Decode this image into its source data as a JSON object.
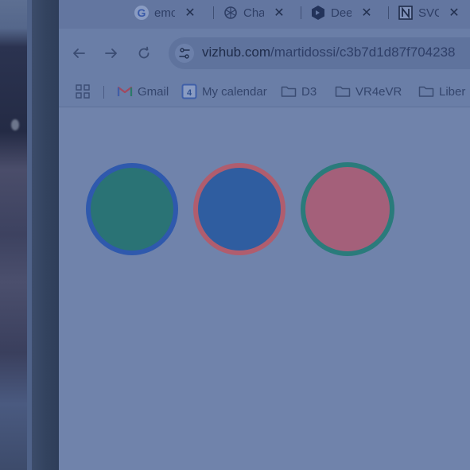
{
  "tabs": [
    {
      "label": "emo",
      "favicon": "google-icon"
    },
    {
      "label": "Cha",
      "favicon": "openai-icon"
    },
    {
      "label": "Dee",
      "favicon": "deepseek-icon"
    },
    {
      "label": "SVG",
      "favicon": "notion-icon"
    }
  ],
  "tab_close_glyph": "✕",
  "toolbar": {
    "back_icon": "back-arrow-icon",
    "forward_icon": "forward-arrow-icon",
    "reload_icon": "reload-icon",
    "site_info_icon": "tune-icon"
  },
  "address": {
    "host": "vizhub.com",
    "path": "/martidossi/c3b7d1d87f704238"
  },
  "bookmarks": [
    {
      "label": "",
      "icon": "apps-grid-icon"
    },
    {
      "label": "Gmail",
      "icon": "gmail-icon"
    },
    {
      "label": "My calendar",
      "icon": "calendar-icon",
      "badge": "4"
    },
    {
      "label": "D3",
      "icon": "folder-icon"
    },
    {
      "label": "VR4eVR",
      "icon": "folder-icon"
    },
    {
      "label": "Liber",
      "icon": "folder-icon"
    }
  ],
  "circles": [
    {
      "fill": "#2a7375",
      "stroke": "#2f59ad"
    },
    {
      "fill": "#2f5da0",
      "stroke": "#b05d6e"
    },
    {
      "fill": "#a4607a",
      "stroke": "#2a7b7b"
    }
  ]
}
